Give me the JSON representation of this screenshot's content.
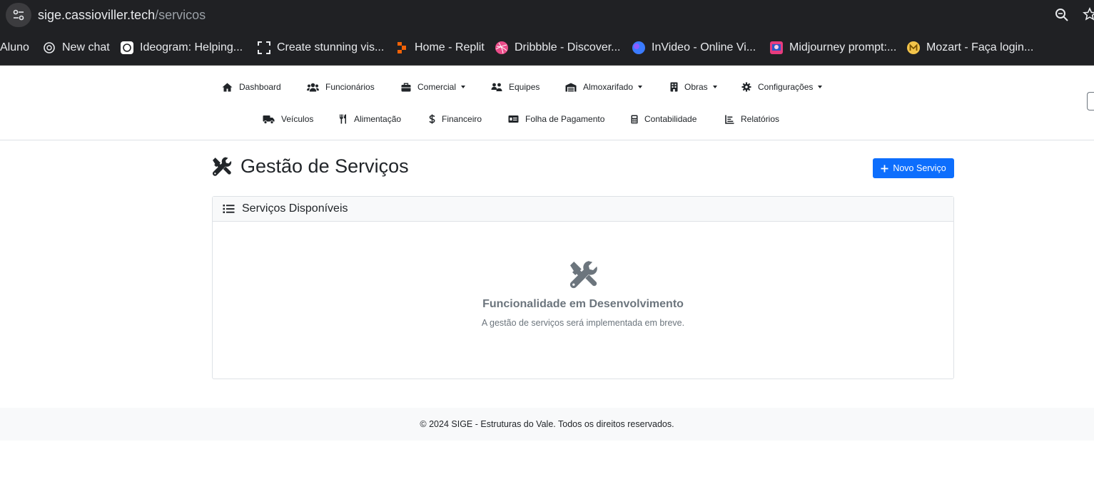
{
  "browser": {
    "url_host": "sige.cassioviller.tech",
    "url_path": "/servicos",
    "bookmarks": [
      {
        "label": "Aluno",
        "icon": "none"
      },
      {
        "label": "New chat",
        "icon": "openai-icon"
      },
      {
        "label": "Ideogram: Helping...",
        "icon": "ideogram-icon"
      },
      {
        "label": "Create stunning vis...",
        "icon": "frame-icon"
      },
      {
        "label": "Home - Replit",
        "icon": "replit-icon"
      },
      {
        "label": "Dribbble - Discover...",
        "icon": "dribbble-icon"
      },
      {
        "label": "InVideo - Online Vi...",
        "icon": "invideo-icon"
      },
      {
        "label": "Midjourney prompt:...",
        "icon": "midjourney-icon"
      },
      {
        "label": "Mozart - Faça login...",
        "icon": "mozart-icon"
      }
    ]
  },
  "nav": {
    "row1": [
      {
        "label": "Dashboard",
        "icon": "home-icon",
        "dropdown": false
      },
      {
        "label": "Funcionários",
        "icon": "users-icon",
        "dropdown": false
      },
      {
        "label": "Comercial",
        "icon": "briefcase-icon",
        "dropdown": true
      },
      {
        "label": "Equipes",
        "icon": "team-icon",
        "dropdown": false
      },
      {
        "label": "Almoxarifado",
        "icon": "warehouse-icon",
        "dropdown": true
      },
      {
        "label": "Obras",
        "icon": "building-icon",
        "dropdown": true
      },
      {
        "label": "Configurações",
        "icon": "gear-icon",
        "dropdown": true
      }
    ],
    "row2": [
      {
        "label": "Veículos",
        "icon": "truck-icon",
        "dropdown": false
      },
      {
        "label": "Alimentação",
        "icon": "utensils-icon",
        "dropdown": false
      },
      {
        "label": "Financeiro",
        "icon": "dollar-icon",
        "dropdown": false
      },
      {
        "label": "Folha de Pagamento",
        "icon": "id-card-icon",
        "dropdown": false
      },
      {
        "label": "Contabilidade",
        "icon": "calculator-icon",
        "dropdown": false
      },
      {
        "label": "Relatórios",
        "icon": "chart-icon",
        "dropdown": false
      }
    ]
  },
  "page": {
    "title": "Gestão de Serviços",
    "new_button": "Novo Serviço"
  },
  "card": {
    "header": "Serviços Disponíveis",
    "empty_title": "Funcionalidade em Desenvolvimento",
    "empty_text": "A gestão de serviços será implementada em breve."
  },
  "footer": {
    "text": "© 2024 SIGE - Estruturas do Vale. Todos os direitos reservados."
  },
  "colors": {
    "primary": "#0d6efd",
    "muted": "#6c757d",
    "chrome": "#202124"
  }
}
